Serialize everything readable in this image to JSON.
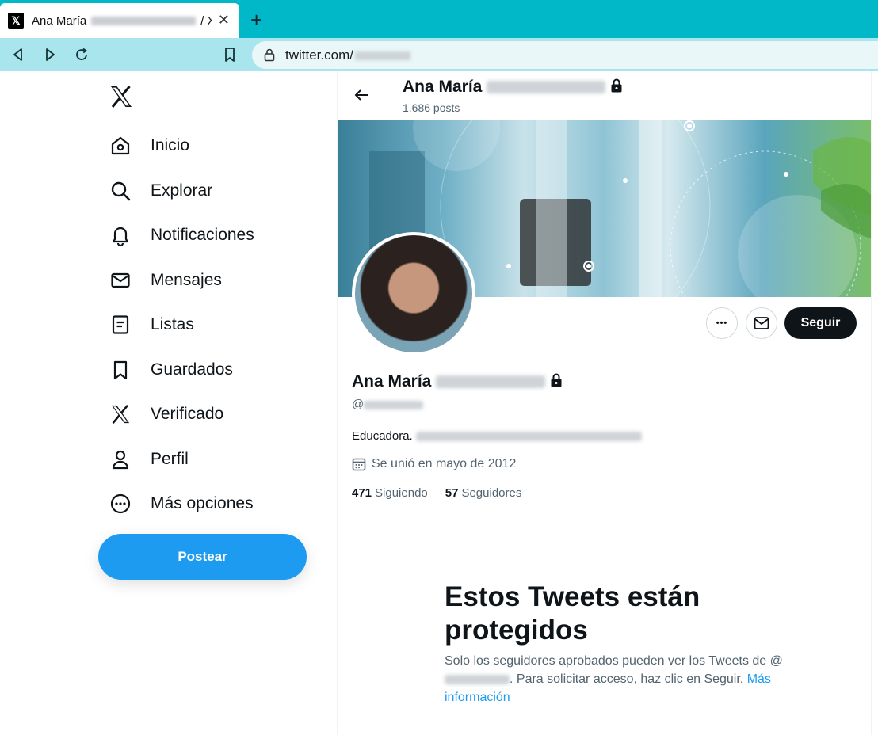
{
  "browser": {
    "tab_title_prefix": "Ana María",
    "tab_title_suffix": "/ X",
    "tab_close": "✕",
    "new_tab": "+",
    "url_prefix": "twitter.com/"
  },
  "sidebar": {
    "items": [
      {
        "label": "Inicio",
        "icon": "home-icon"
      },
      {
        "label": "Explorar",
        "icon": "search-icon"
      },
      {
        "label": "Notificaciones",
        "icon": "bell-icon"
      },
      {
        "label": "Mensajes",
        "icon": "mail-icon"
      },
      {
        "label": "Listas",
        "icon": "list-icon"
      },
      {
        "label": "Guardados",
        "icon": "bookmark-icon"
      },
      {
        "label": "Verificado",
        "icon": "x-logo-icon"
      },
      {
        "label": "Perfil",
        "icon": "person-icon"
      },
      {
        "label": "Más opciones",
        "icon": "more-circle-icon"
      }
    ],
    "post_button": "Postear"
  },
  "header": {
    "name": "Ana María",
    "posts": "1.686 posts"
  },
  "profile": {
    "name": "Ana María",
    "handle_prefix": "@",
    "bio": "Educadora.",
    "joined": "Se unió en mayo de 2012",
    "following_count": "471",
    "following_label": "Siguiendo",
    "followers_count": "57",
    "followers_label": "Seguidores",
    "follow_button": "Seguir",
    "more_button": "•••"
  },
  "protected": {
    "title": "Estos Tweets están protegidos",
    "text_a": "Solo los seguidores aprobados pueden ver los Tweets de @",
    "text_b": ". Para solicitar acceso, haz clic en Seguir.",
    "link": "Más información"
  },
  "colors": {
    "tab_bar": "#00b8c8",
    "nav_bar": "#a9e5ec",
    "accent": "#1d9bf0",
    "follow_button": "#0f1419"
  }
}
